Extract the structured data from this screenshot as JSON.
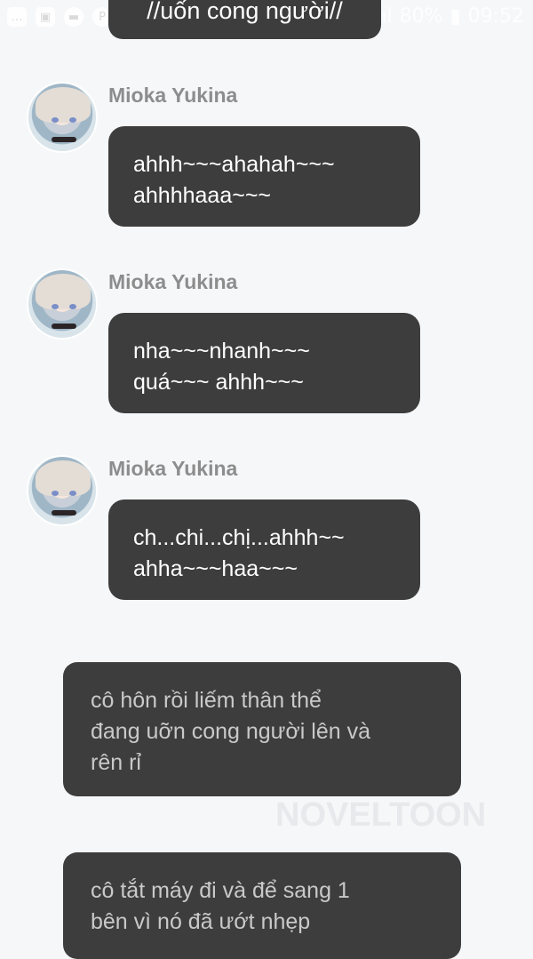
{
  "status_bar": {
    "battery": "80%",
    "time": "09:52",
    "signal": ".ıl",
    "icons": [
      "messenger-icon",
      "gallery-icon",
      "chat-icon",
      "pinterest-icon",
      "chrome-icon",
      "chrome-icon",
      "chrome-icon",
      "chrome-icon",
      "chrome-icon",
      "recycle-icon",
      "mute-icon",
      "no-disturb-icon",
      "wifi-icon",
      "signal-icon",
      "battery-icon"
    ]
  },
  "top_bubble": {
    "text": "//uốn cong người//"
  },
  "messages": [
    {
      "sender": "Mioka Yukina",
      "lines": [
        "ahhh~~~ahahah~~~",
        "ahhhhaaa~~~"
      ]
    },
    {
      "sender": "Mioka Yukina",
      "lines": [
        "nha~~~nhanh~~~",
        "quá~~~ ahhh~~~"
      ]
    },
    {
      "sender": "Mioka Yukina",
      "lines": [
        "ch...chi...chị...ahhh~~",
        "ahha~~~haa~~~"
      ]
    }
  ],
  "narrations": [
    {
      "lines": [
        "cô hôn rồi liếm thân thể",
        "đang uỡn cong người lên  và",
        "rên rỉ"
      ]
    },
    {
      "lines": [
        "cô tắt máy đi và để sang 1",
        "bên vì nó đã ướt nhẹp"
      ]
    }
  ],
  "watermark": "NOVELTOON",
  "colors": {
    "background": "#f6f7f9",
    "bubble": "#3d3d3d",
    "name": "#8d8d8d",
    "narration_text": "#c9c9c9"
  }
}
